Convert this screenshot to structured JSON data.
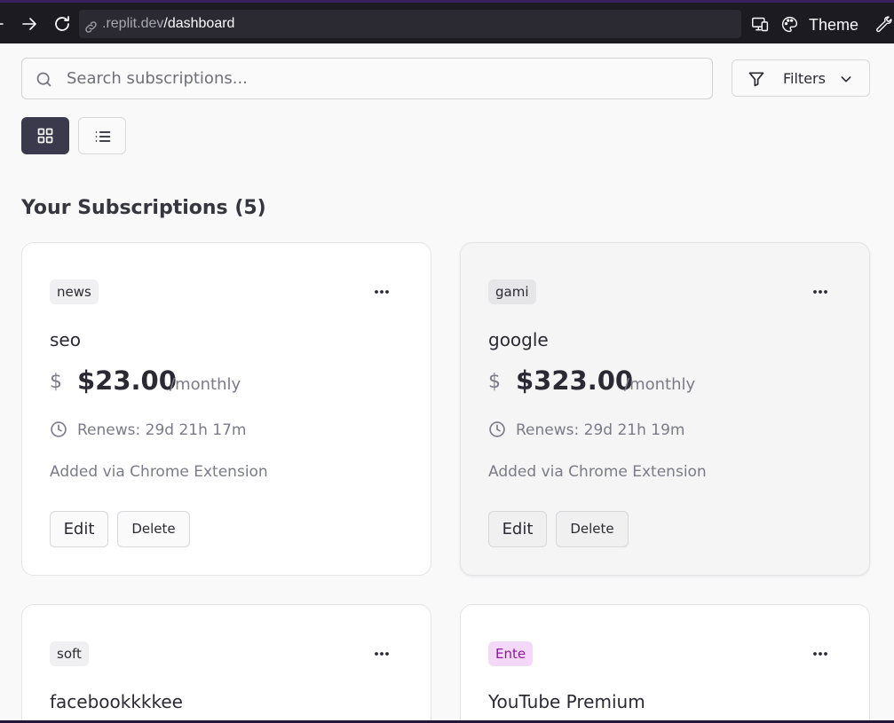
{
  "browser": {
    "url_domain": ".replit.dev",
    "url_path": "/dashboard",
    "theme_label": "Theme"
  },
  "search": {
    "placeholder": "Search subscriptions..."
  },
  "filters": {
    "label": "Filters"
  },
  "section": {
    "title": "Your Subscriptions (5)"
  },
  "cards": [
    {
      "tag": "news",
      "name": "seo",
      "currency": "$",
      "price": "$23.00",
      "period": "/monthly",
      "renews_label": "Renews:",
      "renews_value": "29d 21h 17m",
      "source": "Added via Chrome Extension",
      "edit": "Edit",
      "delete": "Delete"
    },
    {
      "tag": "gami",
      "name": "google",
      "currency": "$",
      "price": "$323.00",
      "period": "/monthly",
      "renews_label": "Renews:",
      "renews_value": "29d 21h 19m",
      "source": "Added via Chrome Extension",
      "edit": "Edit",
      "delete": "Delete"
    },
    {
      "tag": "soft",
      "name": "facebookkkkee"
    },
    {
      "tag": "Ente",
      "name": "YouTube Premium",
      "tag_color": "#8a1b9a"
    }
  ],
  "icons": {
    "nav": [
      "forward-arrow-icon",
      "reload-icon",
      "link-icon"
    ],
    "toolbar": [
      "responsive-design-icon",
      "palette-icon",
      "wrench-icon"
    ],
    "card": [
      "more-icon",
      "currency-icon",
      "clock-icon"
    ]
  }
}
